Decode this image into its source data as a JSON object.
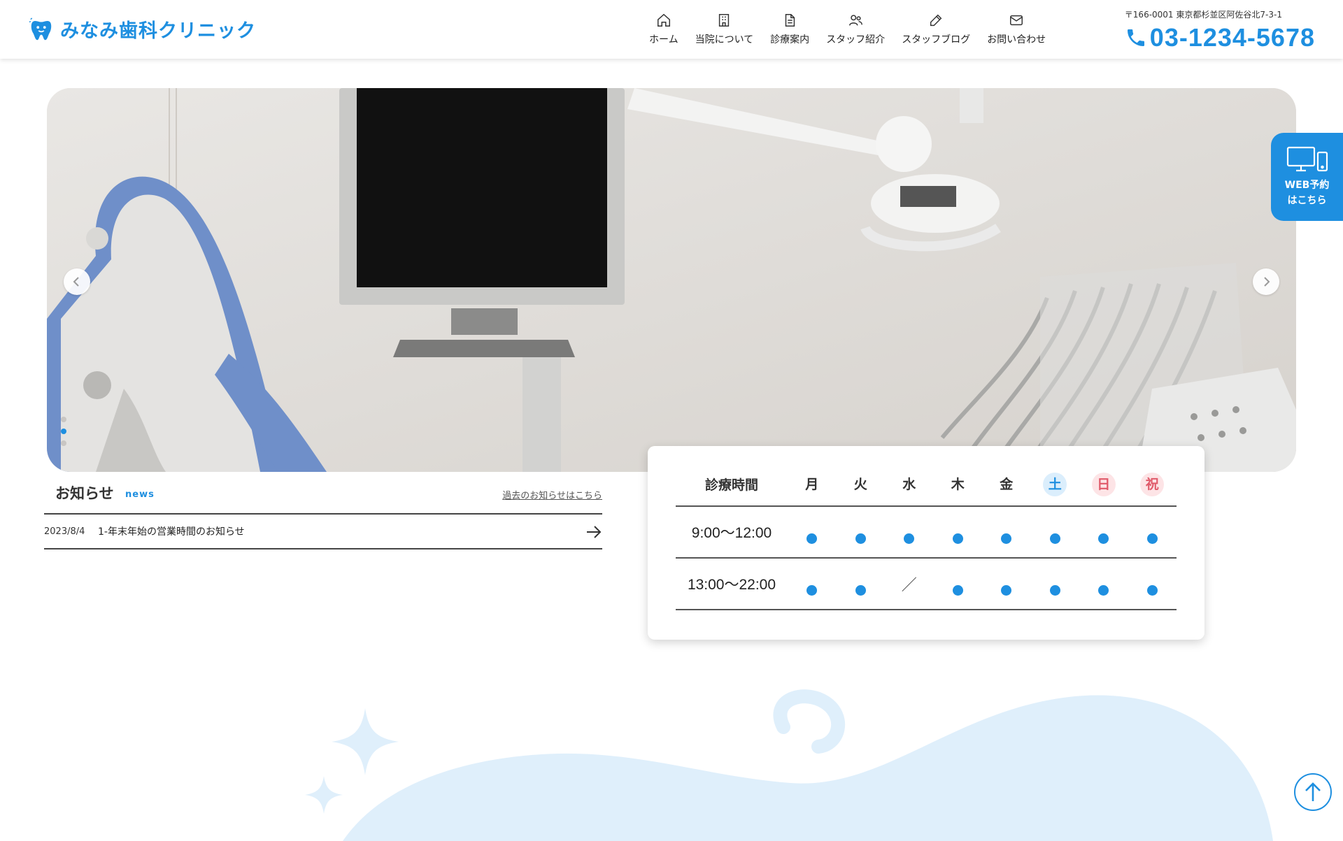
{
  "header": {
    "logo_text": "みなみ歯科クリニック",
    "nav": [
      {
        "label": "ホーム",
        "icon": "home-icon"
      },
      {
        "label": "当院について",
        "icon": "building-icon"
      },
      {
        "label": "診療案内",
        "icon": "document-icon"
      },
      {
        "label": "スタッフ紹介",
        "icon": "people-icon"
      },
      {
        "label": "スタッフブログ",
        "icon": "pencil-icon"
      },
      {
        "label": "お問い合わせ",
        "icon": "mail-icon"
      }
    ],
    "address": "〒166-0001 東京都杉並区阿佐谷北7-3-1",
    "phone": "03-1234-5678"
  },
  "reserve": {
    "line1": "WEB予約",
    "line2": "はこちら",
    "icon": "devices-icon"
  },
  "hero": {
    "slide_count": 3,
    "active_slide": 2
  },
  "news": {
    "title": "お知らせ",
    "subtitle": "news",
    "more_link": "過去のお知らせはこちら",
    "items": [
      {
        "date": "2023/8/4",
        "text": "1-年末年始の営業時間のお知らせ"
      }
    ]
  },
  "hours": {
    "header_label": "診療時間",
    "days": [
      "月",
      "火",
      "水",
      "木",
      "金",
      "土",
      "日",
      "祝"
    ],
    "rows": [
      {
        "time": "9:00〜12:00",
        "marks": [
          "●",
          "●",
          "●",
          "●",
          "●",
          "●",
          "●",
          "●"
        ]
      },
      {
        "time": "13:00〜22:00",
        "marks": [
          "●",
          "●",
          "／",
          "●",
          "●",
          "●",
          "●",
          "●"
        ]
      }
    ]
  },
  "colors": {
    "accent": "#1e8fe0",
    "saturday_bg": "#dbeefc",
    "holiday_bg": "#fde4e6",
    "holiday_text": "#e05a6a",
    "wave": "#dfeffb"
  }
}
